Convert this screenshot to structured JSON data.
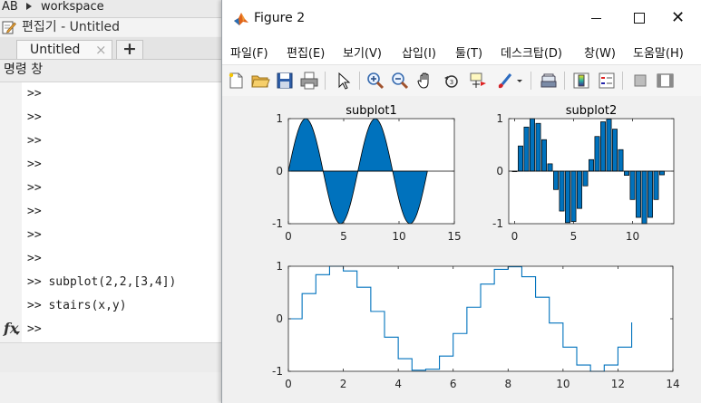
{
  "matlab": {
    "top_prefix": "AB",
    "top_path": "workspace",
    "editor_title": "편집기 - Untitled",
    "tab_label": "Untitled",
    "tab_close": "×",
    "tab_add": "+",
    "command_header": "명령 창",
    "command_lines": [
      ">>",
      ">>",
      ">>",
      ">>",
      ">>",
      ">>",
      ">>",
      ">>",
      ">> subplot(2,2,[3,4])",
      ">> stairs(x,y)",
      ">>"
    ],
    "fx_label": "fx"
  },
  "figure": {
    "title": "Figure 2",
    "close_glyph": "✕",
    "menu": [
      "파일(F)",
      "편집(E)",
      "보기(V)",
      "삽입(I)",
      "툴(T)",
      "데스크탑(D)",
      "창(W)",
      "도움말(H)"
    ],
    "toolbar_icons": [
      "new-figure-icon",
      "open-file-icon",
      "save-icon",
      "print-icon",
      "pointer-icon",
      "zoom-in-icon",
      "zoom-out-icon",
      "pan-hand-icon",
      "rotate-3d-icon",
      "data-cursor-icon",
      "brush-icon",
      "link-plot-icon",
      "colorbar-icon",
      "legend-icon",
      "hide-plot-tools-icon",
      "show-plot-tools-icon"
    ],
    "colors": {
      "bar_fill": "#0072BD",
      "line": "#0072BD"
    }
  },
  "chart_data": [
    {
      "type": "area",
      "title": "subplot1",
      "xlim": [
        0,
        15
      ],
      "ylim": [
        -1,
        1
      ],
      "xticks": [
        0,
        5,
        10,
        15
      ],
      "yticks": [
        -1,
        0,
        1
      ],
      "series": [
        {
          "function": "sin(x)",
          "x_range": [
            0,
            12.566
          ],
          "color": "#0072BD"
        }
      ]
    },
    {
      "type": "bar",
      "title": "subplot2",
      "xlim": [
        -0.5,
        13.5
      ],
      "ylim": [
        -1,
        1
      ],
      "xticks": [
        0,
        5,
        10
      ],
      "yticks": [
        -1,
        0,
        1
      ],
      "x": [
        0,
        0.5,
        1,
        1.5,
        2,
        2.5,
        3,
        3.5,
        4,
        4.5,
        5,
        5.5,
        6,
        6.5,
        7,
        7.5,
        8,
        8.5,
        9,
        9.5,
        10,
        10.5,
        11,
        11.5,
        12,
        12.5
      ],
      "values": [
        0,
        0.48,
        0.84,
        1.0,
        0.91,
        0.6,
        0.14,
        -0.35,
        -0.76,
        -0.98,
        -0.96,
        -0.71,
        -0.28,
        0.22,
        0.66,
        0.94,
        0.99,
        0.8,
        0.41,
        -0.08,
        -0.54,
        -0.88,
        -1.0,
        -0.88,
        -0.54,
        -0.07
      ]
    },
    {
      "type": "line",
      "subtype": "stairs",
      "title": "",
      "xlim": [
        0,
        14
      ],
      "ylim": [
        -1,
        1
      ],
      "xticks": [
        0,
        2,
        4,
        6,
        8,
        10,
        12,
        14
      ],
      "yticks": [
        -1,
        0,
        1
      ],
      "x": [
        0,
        0.5,
        1,
        1.5,
        2,
        2.5,
        3,
        3.5,
        4,
        4.5,
        5,
        5.5,
        6,
        6.5,
        7,
        7.5,
        8,
        8.5,
        9,
        9.5,
        10,
        10.5,
        11,
        11.5,
        12,
        12.5
      ],
      "y": [
        0,
        0.48,
        0.84,
        1.0,
        0.91,
        0.6,
        0.14,
        -0.35,
        -0.76,
        -0.98,
        -0.96,
        -0.71,
        -0.28,
        0.22,
        0.66,
        0.94,
        0.99,
        0.8,
        0.41,
        -0.08,
        -0.54,
        -0.88,
        -1.0,
        -0.88,
        -0.54,
        -0.07
      ]
    }
  ]
}
